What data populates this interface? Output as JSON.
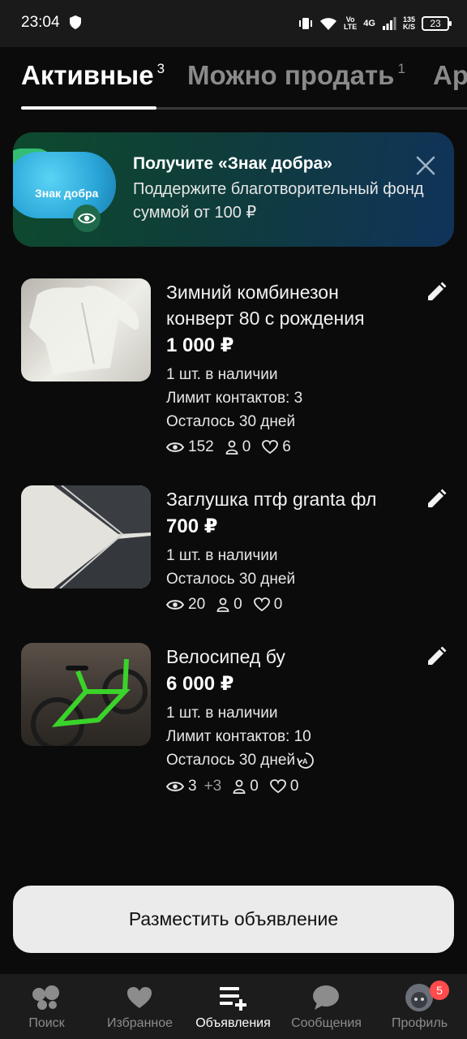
{
  "status_bar": {
    "time": "23:04",
    "network_small_1": "Vo",
    "network_small_2": "LTE",
    "network_4g": "4G",
    "speed_value": "135",
    "speed_unit": "K/S",
    "battery": "23"
  },
  "tabs": [
    {
      "label": "Активные",
      "count": "3"
    },
    {
      "label": "Можно продать",
      "count": "1"
    },
    {
      "label": "Ар",
      "count": ""
    }
  ],
  "promo": {
    "badge_text": "Знак добра",
    "title": "Получите «Знак добра»",
    "body": "Поддержите благотворительный фонд суммой от 100 ₽"
  },
  "listings": [
    {
      "title": "Зимний комбинезон конверт 80 с рождения",
      "price": "1 000 ₽",
      "stock": "1 шт. в наличии",
      "limit": "Лимит контактов: 3",
      "days": "Осталось 30 дней",
      "views": "152",
      "views_plus": "",
      "contacts": "0",
      "favorites": "6"
    },
    {
      "title": "Заглушка птф granta фл",
      "price": "700 ₽",
      "stock": "1 шт. в наличии",
      "limit": "",
      "days": "Осталось 30 дней",
      "views": "20",
      "views_plus": "",
      "contacts": "0",
      "favorites": "0"
    },
    {
      "title": "Велосипед бу",
      "price": "6 000 ₽",
      "stock": "1 шт. в наличии",
      "limit": "Лимит контактов: 10",
      "days": "Осталось 30 дней",
      "views": "3",
      "views_plus": "+3",
      "contacts": "0",
      "favorites": "0"
    }
  ],
  "cta": {
    "label": "Разместить объявление"
  },
  "bottom_nav": [
    {
      "label": "Поиск",
      "icon": "search-bubbles-icon"
    },
    {
      "label": "Избранное",
      "icon": "heart-icon"
    },
    {
      "label": "Объявления",
      "icon": "listings-add-icon",
      "active": true
    },
    {
      "label": "Сообщения",
      "icon": "chat-icon"
    },
    {
      "label": "Профиль",
      "icon": "avatar-icon",
      "badge": "5"
    }
  ],
  "colors": {
    "background": "#0b0b0b",
    "tab_inactive": "#8a8a8a",
    "badge": "#ff4b4b",
    "promo_start": "#0e4a2e",
    "promo_end": "#10335a"
  }
}
